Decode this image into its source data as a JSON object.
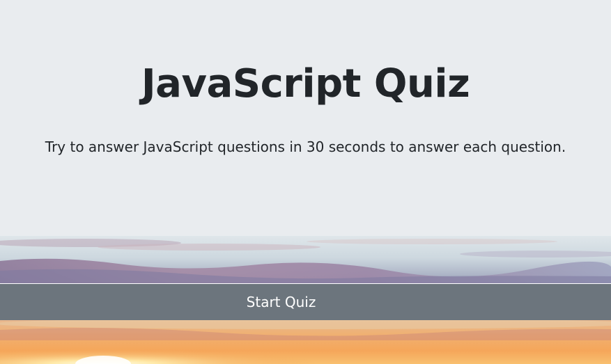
{
  "header": {
    "title": "JavaScript Quiz",
    "subtitle": "Try to answer JavaScript questions in 30 seconds to answer each question."
  },
  "actions": {
    "start_label": "Start Quiz"
  },
  "colors": {
    "jumbotron_bg": "#e9ecef",
    "text": "#212529",
    "button_bg": "#6c757d",
    "button_text": "#ffffff"
  }
}
